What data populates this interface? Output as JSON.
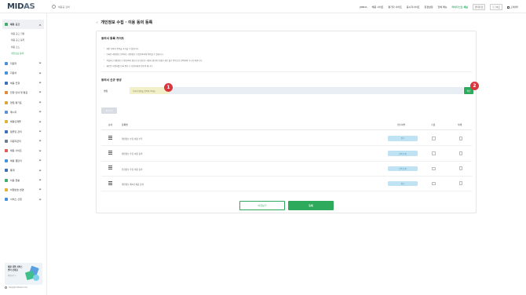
{
  "header": {
    "logo_main": "MID",
    "logo_accent": "AS",
    "search_placeholder": "채용공 검색",
    "nav": [
      "JOBDA",
      "채용 사이트",
      "평가자 사이트",
      "응시자사이트"
    ],
    "nav_links": [
      "환경설정",
      "전체 메뉴"
    ],
    "accent_link": "마이다스인 채널",
    "user": "관리자 님",
    "logout": "로그아웃",
    "admin": "고객센터"
  },
  "sidebar": {
    "items": [
      {
        "label": "채용 공고",
        "icon": "briefcase-icon",
        "color": "#3fae6a",
        "active": true
      },
      {
        "label": "지원자",
        "icon": "person-icon",
        "color": "#4a90d9"
      },
      {
        "label": "지원서",
        "icon": "document-icon",
        "color": "#4a90d9"
      },
      {
        "label": "채용 전형",
        "icon": "folder-icon",
        "color": "#3d6fb6"
      },
      {
        "label": "전형 안내 및 발표",
        "icon": "announce-icon",
        "color": "#e08a3c"
      },
      {
        "label": "면접 평가표",
        "icon": "star-icon",
        "color": "#d9a53c"
      },
      {
        "label": "메시지",
        "icon": "message-icon",
        "color": "#5b8ed6"
      },
      {
        "label": "채용인재풀",
        "icon": "pool-icon",
        "color": "#e0b23c"
      },
      {
        "label": "템플릿 관리",
        "icon": "template-icon",
        "color": "#3d6fb6"
      },
      {
        "label": "지원자관리",
        "icon": "manage-icon",
        "color": "#6b7b8c"
      },
      {
        "label": "채용 사이트",
        "icon": "site-icon",
        "color": "#e05a5a"
      },
      {
        "label": "채용 캘린더",
        "icon": "calendar-icon",
        "color": "#4a90d9"
      },
      {
        "label": "통계",
        "icon": "chart-icon",
        "color": "#3d6fb6"
      },
      {
        "label": "이용 현황",
        "icon": "usage-icon",
        "color": "#3fae6a"
      },
      {
        "label": "비밀번호 변경",
        "icon": "lock-icon",
        "color": "#e0b23c"
      },
      {
        "label": "서비스 신청",
        "icon": "grid-icon",
        "color": "#4a90d9"
      }
    ],
    "submenu": [
      "채용 공고 현황",
      "채용 공고 등록",
      "채용 코드",
      "개인정보 동의"
    ],
    "current_submenu": 3,
    "promo_line1": "채용 대행 서비스",
    "promo_line2": "받아 보세요",
    "promo_sub": "바로가기 >",
    "footer": "help@midasit.com"
  },
  "page": {
    "back": "<",
    "title": "개인정보 수집 · 이용 동의 등록"
  },
  "guide": {
    "title": "동의서 등록 가이드",
    "lines": [
      "개인 동의서 항목을 추가할 수 있습니다.",
      "등록된 개인정보 동의서는 개인정보 수집동의서에 적용될 수 있습니다.",
      "작성하신 개인정보 수집동의서 정보가 한 정보가 지원자 정보와 동일한 경우 필수 항목으로 선택하여 주시기 바랍니다.",
      "새로운 지원자를 등록 완료 시 지원자에게 전송이 됩니다."
    ]
  },
  "form": {
    "title": "동의서 신규 생성",
    "name_label": "명칭",
    "name_placeholder": "동의서 명칭을 입력해 주세요",
    "confirm": "확인",
    "add": "항목 추가"
  },
  "markers": [
    "1",
    "2"
  ],
  "table": {
    "headers": {
      "order": "순서",
      "name": "항목명",
      "status": "필수여부",
      "edit": "수정",
      "delete": "삭제"
    },
    "rows": [
      {
        "name": "개인정보 수집 이용 수칙",
        "status": "필수",
        "color": "#bfe3f3"
      },
      {
        "name": "개인정보 수집 이용 동의",
        "status": "선택 동의",
        "color": "#bfe3f3"
      },
      {
        "name": "민감정보 수집 이용 동의",
        "status": "선택 동의",
        "color": "#bfe3f3"
      },
      {
        "name": "개인정보 제3자 제공 동의",
        "status": "필수",
        "color": "#bfe3f3"
      }
    ]
  },
  "actions": {
    "cancel": "이전보기",
    "submit": "등록"
  },
  "colors": {
    "accent": "#2eaa5c",
    "marker": "#d9363e"
  }
}
